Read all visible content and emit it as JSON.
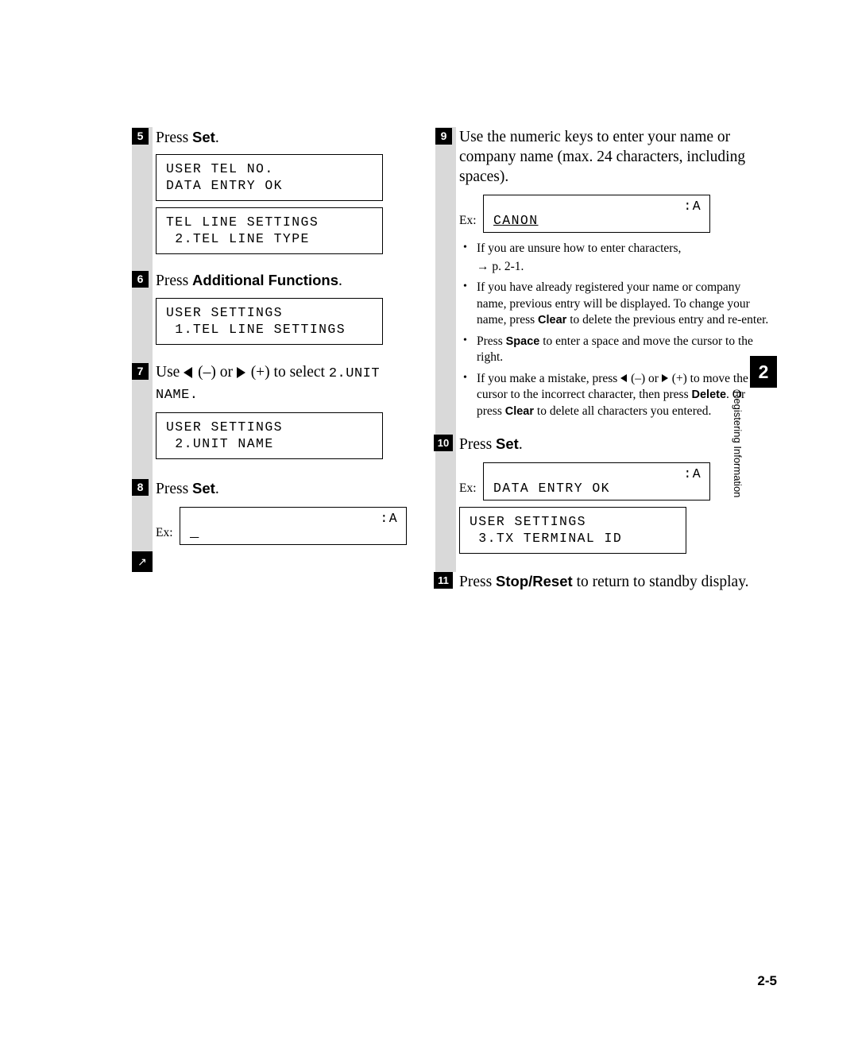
{
  "page": {
    "number": "2-5",
    "side_tab": {
      "number": "2",
      "label": "Registering Information"
    },
    "arrow_marker": "↗"
  },
  "left_column": {
    "steps": [
      {
        "num": "5",
        "text_before": "Press ",
        "bold": "Set",
        "text_after": ".",
        "lcds": [
          {
            "line1": "USER TEL NO.",
            "line2": "DATA ENTRY OK"
          },
          {
            "line1": "TEL LINE SETTINGS",
            "line2": " 2.TEL LINE TYPE"
          }
        ]
      },
      {
        "num": "6",
        "text_before": "Press ",
        "bold": "Additional Functions",
        "text_after": ".",
        "lcds": [
          {
            "line1": "USER SETTINGS",
            "line2": " 1.TEL LINE SETTINGS"
          }
        ]
      },
      {
        "num": "7",
        "text_before": "Use ",
        "text_mid1": " (–) or ",
        "text_mid2": " (+) to select ",
        "mono": "2.UNIT",
        "text_after": "NAME.",
        "lcds": [
          {
            "line1": "USER SETTINGS",
            "line2": " 2.UNIT NAME"
          }
        ]
      },
      {
        "num": "8",
        "text_before": "Press ",
        "bold": "Set",
        "text_after": ".",
        "ex_label": "Ex:",
        "ex_right": ":A",
        "ex_entry": "_"
      }
    ]
  },
  "right_column": {
    "step9": {
      "num": "9",
      "text": "Use the numeric keys to enter your name or company name (max. 24 characters, including spaces).",
      "ex_label": "Ex:",
      "ex_right": ":A",
      "ex_entry": "CANON",
      "bullets": [
        {
          "parts": [
            {
              "t": "If you are unsure how to enter characters,",
              "b": false
            }
          ],
          "second_line": "→ p. 2-1."
        },
        {
          "parts": [
            {
              "t": "If you have already registered your name or company name, previous entry will be displayed. To change your name, press ",
              "b": false
            },
            {
              "t": "Clear",
              "b": true
            },
            {
              "t": " to delete the previous entry and re-enter.",
              "b": false
            }
          ]
        },
        {
          "parts": [
            {
              "t": "Press ",
              "b": false
            },
            {
              "t": "Space",
              "b": true
            },
            {
              "t": " to enter a space and move the cursor to the right.",
              "b": false
            }
          ]
        },
        {
          "parts": [
            {
              "t": "If you make a mistake, press ",
              "b": false
            },
            {
              "t": "ARROW_LEFT",
              "b": false,
              "icon": true
            },
            {
              "t": " (–) or ",
              "b": false
            },
            {
              "t": "ARROW_RIGHT",
              "b": false,
              "icon": true
            },
            {
              "t": " (+) to move the cursor to the incorrect character, then press ",
              "b": false
            },
            {
              "t": "Delete",
              "b": true
            },
            {
              "t": ". Or press ",
              "b": false
            },
            {
              "t": "Clear",
              "b": true
            },
            {
              "t": " to delete all characters you entered.",
              "b": false
            }
          ]
        }
      ]
    },
    "step10": {
      "num": "10",
      "text_before": "Press ",
      "bold": "Set",
      "text_after": ".",
      "ex_label": "Ex:",
      "ex_right": ":A",
      "ex_entry": "DATA ENTRY OK",
      "lcd": {
        "line1": "USER SETTINGS",
        "line2": " 3.TX TERMINAL ID"
      }
    },
    "step11": {
      "num": "11",
      "text_before": "Press ",
      "bold": "Stop/Reset",
      "text_after": " to return to standby display."
    }
  }
}
